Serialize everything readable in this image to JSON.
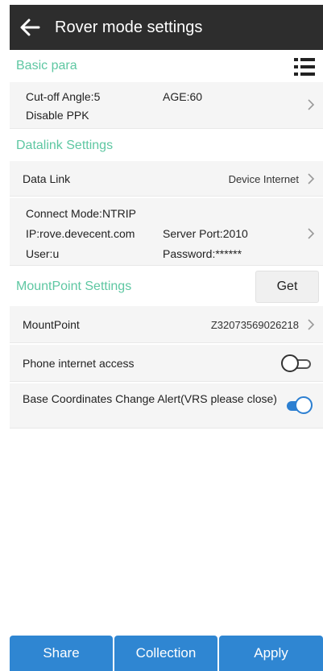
{
  "header": {
    "title": "Rover mode settings",
    "back_icon": "arrow-left-icon"
  },
  "basic": {
    "section_title": "Basic para",
    "menu_icon": "list-menu-icon",
    "cutoff_angle": "Cut-off Angle:5",
    "age": "AGE:60",
    "ppk": "Disable PPK"
  },
  "datalink": {
    "section_title": "Datalink Settings",
    "label": "Data Link",
    "value": "Device Internet",
    "connect_mode": "Connect Mode:NTRIP",
    "ip": "IP:rove.devecent.com",
    "server_port": "Server Port:2010",
    "user": "User:u",
    "password": "Password:******"
  },
  "mountpoint": {
    "section_title": "MountPoint Settings",
    "get_label": "Get",
    "label": "MountPoint",
    "value": "Z32073569026218",
    "phone_internet_label": "Phone internet access",
    "phone_internet_on": false,
    "base_alert_label": "Base Coordinates Change Alert(VRS please close)",
    "base_alert_on": true
  },
  "footer": {
    "share_label": "Share",
    "collection_label": "Collection",
    "apply_label": "Apply"
  },
  "colors": {
    "accent_green": "#5ec7a2",
    "toggle_blue": "#2c7fd1",
    "button_blue": "#2f86d2",
    "topbar": "#2d2d2d"
  }
}
